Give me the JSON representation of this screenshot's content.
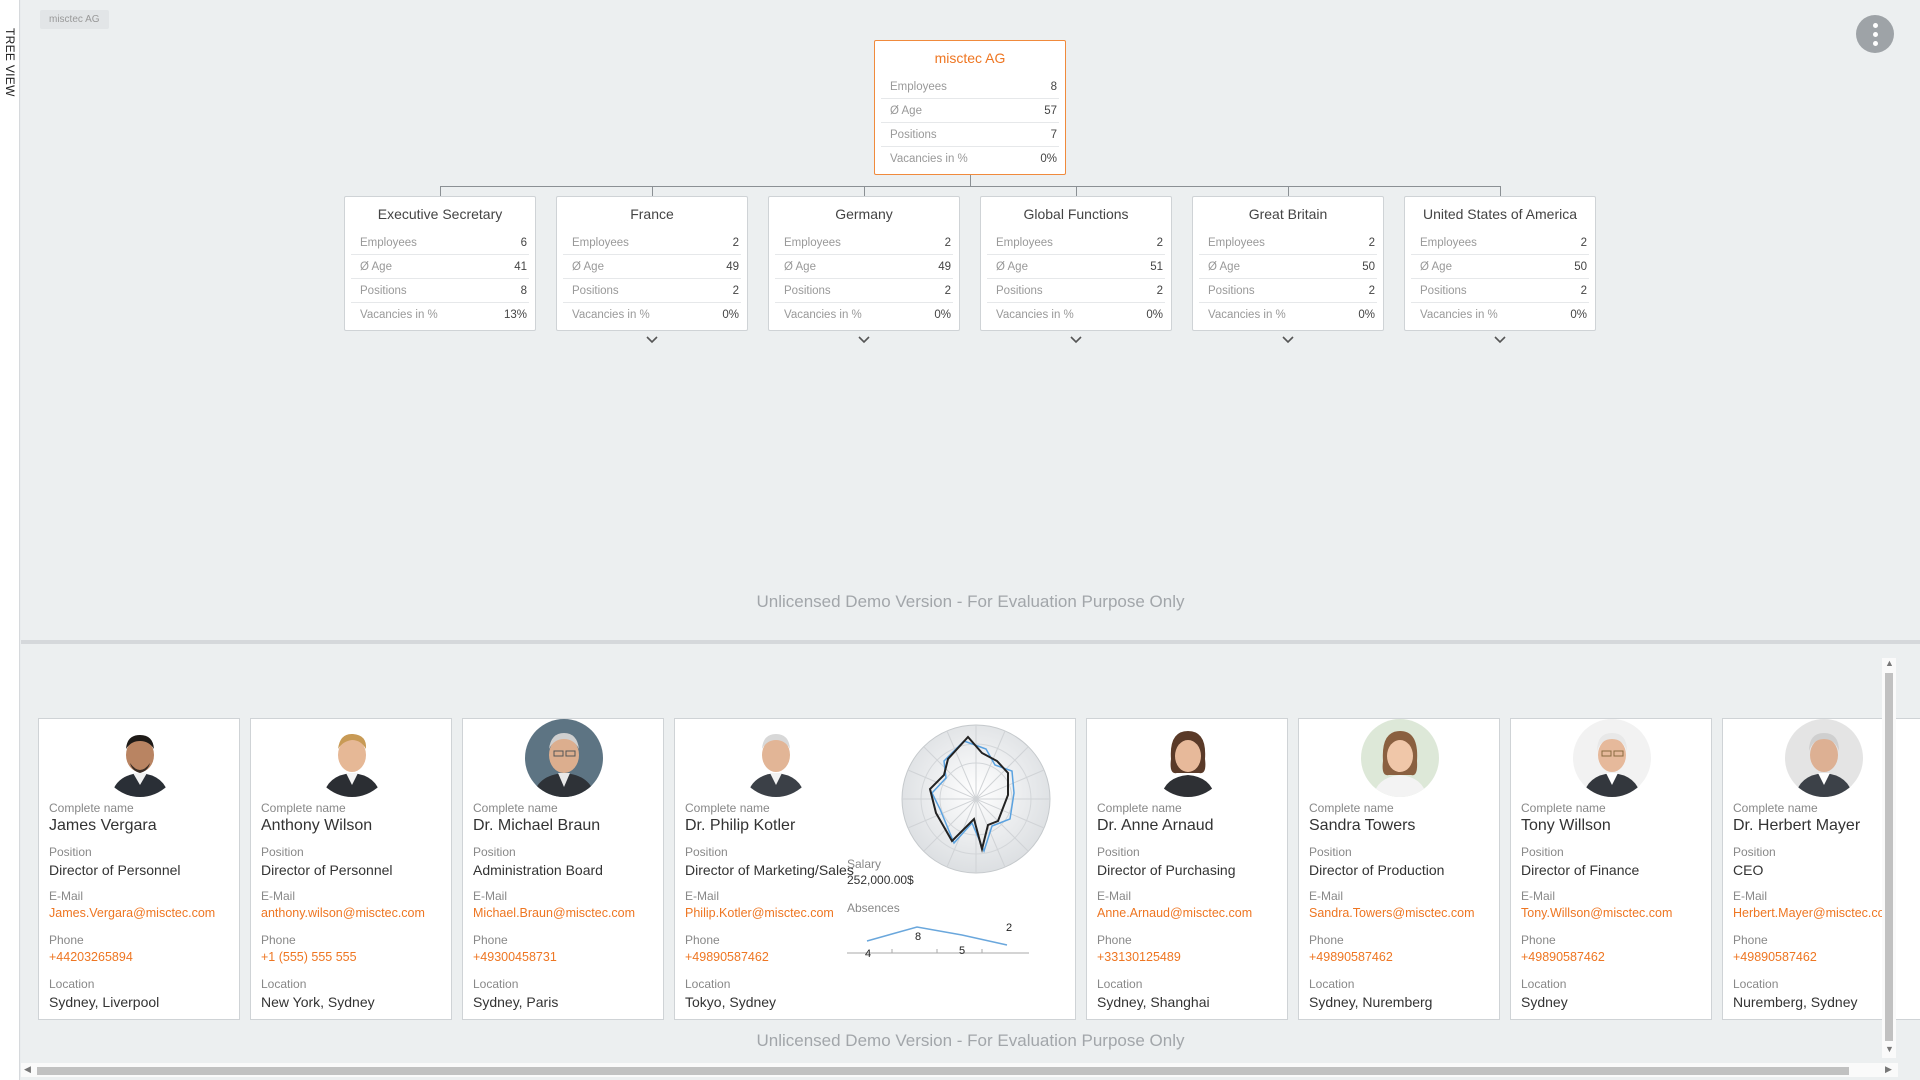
{
  "side_panel": {
    "label": "TREE VIEW"
  },
  "breadcrumb": "misctec AG",
  "menu": {
    "icon": "more-vertical-icon"
  },
  "kpi_labels": {
    "employees": "Employees",
    "age": "Ø Age",
    "positions": "Positions",
    "vacancies": "Vacancies in %"
  },
  "root": {
    "name": "misctec AG",
    "employees": "8",
    "age": "57",
    "positions": "7",
    "vacancies": "0%"
  },
  "units": [
    {
      "name": "Executive Secretary",
      "employees": "6",
      "age": "41",
      "positions": "8",
      "vacancies": "13%",
      "expandable": false
    },
    {
      "name": "France",
      "employees": "2",
      "age": "49",
      "positions": "2",
      "vacancies": "0%",
      "expandable": true
    },
    {
      "name": "Germany",
      "employees": "2",
      "age": "49",
      "positions": "2",
      "vacancies": "0%",
      "expandable": true
    },
    {
      "name": "Global Functions",
      "employees": "2",
      "age": "51",
      "positions": "2",
      "vacancies": "0%",
      "expandable": true
    },
    {
      "name": "Great Britain",
      "employees": "2",
      "age": "50",
      "positions": "2",
      "vacancies": "0%",
      "expandable": true
    },
    {
      "name": "United States of America",
      "employees": "2",
      "age": "50",
      "positions": "2",
      "vacancies": "0%",
      "expandable": true
    }
  ],
  "watermark": "Unlicensed Demo Version - For Evaluation Purpose Only",
  "card_labels": {
    "name": "Complete name",
    "position": "Position",
    "email": "E-Mail",
    "phone": "Phone",
    "location": "Location",
    "salary": "Salary",
    "absences": "Absences"
  },
  "people": [
    {
      "name": "James Vergara",
      "position": "Director of Personnel",
      "email": "James.Vergara@misctec.com",
      "phone": "+44203265894",
      "location": "Sydney, Liverpool"
    },
    {
      "name": "Anthony Wilson",
      "position": "Director of Personnel",
      "email": "anthony.wilson@misctec.com",
      "phone": "+1 (555) 555 555",
      "location": "New York, Sydney"
    },
    {
      "name": "Dr. Michael Braun",
      "position": "Administration Board",
      "email": "Michael.Braun@misctec.com",
      "phone": "+49300458731",
      "location": "Sydney, Paris"
    },
    {
      "name": "Dr. Philip Kotler",
      "position": "Director of Marketing/Sales",
      "email": "Philip.Kotler@misctec.com",
      "phone": "+49890587462",
      "location": "Tokyo, Sydney",
      "salary": "252,000.00$",
      "absences": [
        "4",
        "8",
        "5",
        "2"
      ]
    },
    {
      "name": "Dr. Anne Arnaud",
      "position": "Director of Purchasing",
      "email": "Anne.Arnaud@misctec.com",
      "phone": "+33130125489",
      "location": "Sydney, Shanghai"
    },
    {
      "name": "Sandra Towers",
      "position": "Director of Production",
      "email": "Sandra.Towers@misctec.com",
      "phone": "+49890587462",
      "location": "Sydney, Nuremberg"
    },
    {
      "name": "Tony Willson",
      "position": "Director of Finance",
      "email": "Tony.Willson@misctec.com",
      "phone": "+49890587462",
      "location": "Sydney"
    },
    {
      "name": "Dr. Herbert Mayer",
      "position": "CEO",
      "email": "Herbert.Mayer@misctec.com",
      "phone": "+49890587462",
      "location": "Nuremberg, Sydney"
    }
  ]
}
